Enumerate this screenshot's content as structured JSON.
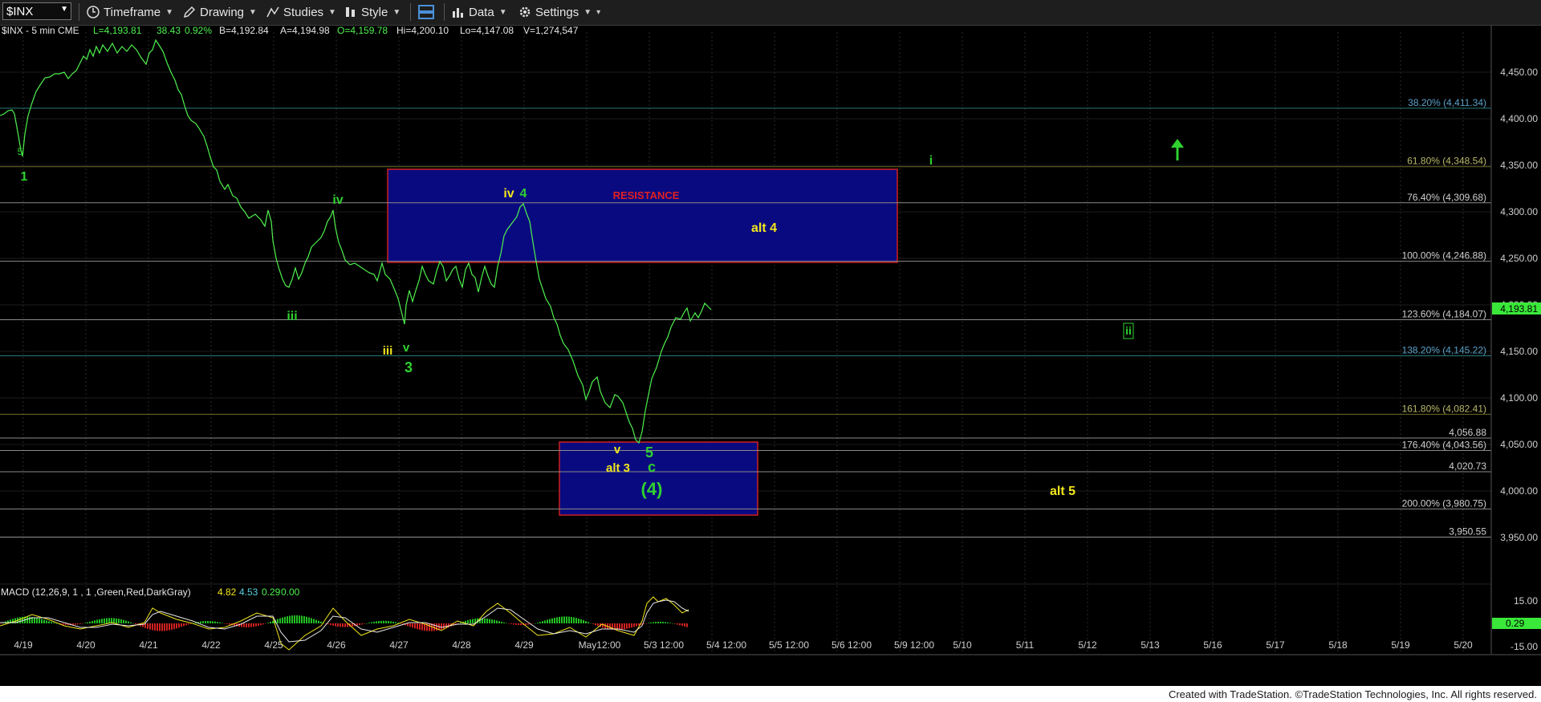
{
  "toolbar": {
    "symbol": "$INX",
    "items": [
      "Timeframe",
      "Drawing",
      "Studies",
      "Style",
      "Data",
      "Settings"
    ]
  },
  "header": {
    "title": "$INX - 5 min  CME",
    "L": "L=4,193.81",
    "chg": "38.43",
    "pct": "0.92%",
    "B": "B=4,192.84",
    "A": "A=4,194.98",
    "O": "O=4,159.78",
    "Hi": "Hi=4,200.10",
    "Lo": "Lo=4,147.08",
    "V": "V=1,274,547"
  },
  "colors": {
    "price": "#4ef04e",
    "wave_yellow": "#f2e61c",
    "wave_green": "#2fd12f",
    "box_fill": "#0a0a7a",
    "box_border": "#d02020",
    "fib_label": "#5aa0c8"
  },
  "fib_levels": [
    {
      "label": "38.20% (4,411.34)",
      "value": 4411.34
    },
    {
      "label": "61.80% (4,348.54)",
      "value": 4348.54
    },
    {
      "label": "76.40% (4,309.68)",
      "value": 4309.68
    },
    {
      "label": "100.00% (4,246.88)",
      "value": 4246.88
    },
    {
      "label": "123.60% (4,184.07)",
      "value": 4184.07
    },
    {
      "label": "138.20% (4,145.22)",
      "value": 4145.22
    },
    {
      "label": "161.80% (4,082.41)",
      "value": 4082.41
    },
    {
      "label": "4,056.88",
      "value": 4056.88
    },
    {
      "label": "176.40% (4,043.56)",
      "value": 4043.56
    },
    {
      "label": "4,020.73",
      "value": 4020.73
    },
    {
      "label": "200.00% (3,980.75)",
      "value": 3980.75
    },
    {
      "label": "3,950.55",
      "value": 3950.55
    }
  ],
  "price_axis": [
    "4,450.00",
    "4,400.00",
    "4,350.00",
    "4,300.00",
    "4,250.00",
    "4,200.00",
    "4,150.00",
    "4,100.00",
    "4,050.00",
    "4,000.00",
    "3,950.00"
  ],
  "last_price_tag": "4,193.81",
  "resistance_label": "RESISTANCE",
  "wave_labels": [
    {
      "text": "5",
      "color": "green",
      "size": 12
    },
    {
      "text": "1",
      "color": "green",
      "size": 16
    },
    {
      "text": "iv",
      "color": "green",
      "size": 16
    },
    {
      "text": "iii",
      "color": "green",
      "size": 16
    },
    {
      "text": "iii",
      "color": "yellow",
      "size": 15
    },
    {
      "text": "v",
      "color": "green",
      "size": 15
    },
    {
      "text": "3",
      "color": "green",
      "size": 18
    },
    {
      "text": "iv",
      "color": "yellow",
      "size": 16
    },
    {
      "text": "4",
      "color": "green",
      "size": 16
    },
    {
      "text": "alt 4",
      "color": "yellow",
      "size": 16
    },
    {
      "text": "v",
      "color": "yellow",
      "size": 15
    },
    {
      "text": "5",
      "color": "green",
      "size": 18
    },
    {
      "text": "alt 3",
      "color": "yellow",
      "size": 15
    },
    {
      "text": "c",
      "color": "green",
      "size": 18
    },
    {
      "text": "(4)",
      "color": "green",
      "size": 22
    },
    {
      "text": "alt 5",
      "color": "yellow",
      "size": 16
    },
    {
      "text": "i",
      "color": "green",
      "size": 16
    },
    {
      "text": "ii",
      "color": "green",
      "size": 14
    }
  ],
  "macd": {
    "label": "MACD (12,26,9, 1 , 1 ,Green,Red,DarkGray)",
    "v1": "4.82",
    "v2": "4.53",
    "v3": "0.29",
    "v4": "0.00",
    "axis": [
      "15.00",
      "-15.00"
    ],
    "tag": "0.29"
  },
  "time_axis": [
    "4/19",
    "4/20",
    "4/21",
    "4/22",
    "4/25",
    "4/26",
    "4/27",
    "4/28",
    "4/29",
    "May12:00",
    "5/3 12:00",
    "5/4 12:00",
    "5/5 12:00",
    "5/6 12:00",
    "5/9 12:00",
    "5/10",
    "5/11",
    "5/12",
    "5/13",
    "5/16",
    "5/17",
    "5/18",
    "5/19",
    "5/20"
  ],
  "credit": "Created with TradeStation. ©TradeStation Technologies, Inc. All rights reserved."
}
